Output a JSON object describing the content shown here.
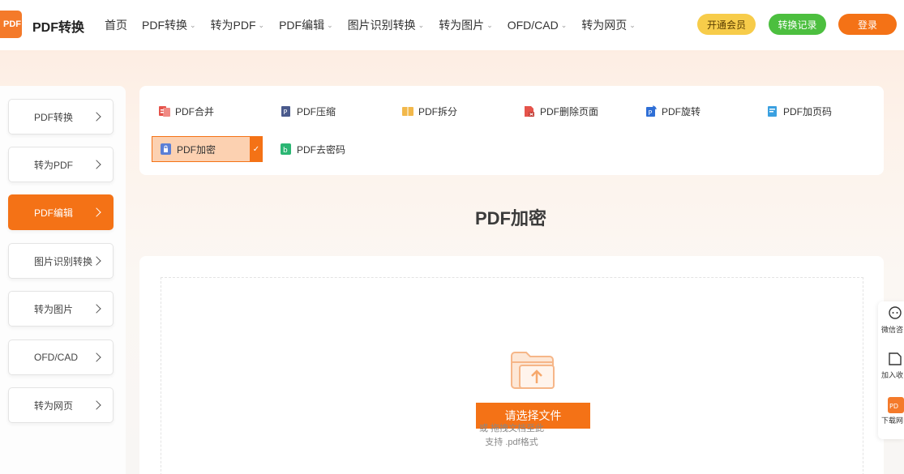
{
  "header": {
    "logo_text": "PDF",
    "brand": "PDF转换",
    "nav": [
      {
        "label": "首页",
        "has_dropdown": false
      },
      {
        "label": "PDF转换",
        "has_dropdown": true
      },
      {
        "label": "转为PDF",
        "has_dropdown": true
      },
      {
        "label": "PDF编辑",
        "has_dropdown": true
      },
      {
        "label": "图片识别转换",
        "has_dropdown": true
      },
      {
        "label": "转为图片",
        "has_dropdown": true
      },
      {
        "label": "OFD/CAD",
        "has_dropdown": true
      },
      {
        "label": "转为网页",
        "has_dropdown": true
      }
    ],
    "vip_label": "开通会员",
    "record_label": "转换记录",
    "login_label": "登录"
  },
  "sidebar": {
    "items": [
      {
        "label": "PDF转换",
        "active": false
      },
      {
        "label": "转为PDF",
        "active": false
      },
      {
        "label": "PDF编辑",
        "active": true
      },
      {
        "label": "图片识别转换",
        "active": false
      },
      {
        "label": "转为图片",
        "active": false
      },
      {
        "label": "OFD/CAD",
        "active": false
      },
      {
        "label": "转为网页",
        "active": false
      }
    ]
  },
  "tools": {
    "items": [
      {
        "label": "PDF合并",
        "icon": "merge-icon",
        "color": "#e5534b"
      },
      {
        "label": "PDF压缩",
        "icon": "compress-icon",
        "color": "#4a5a8c"
      },
      {
        "label": "PDF拆分",
        "icon": "split-icon",
        "color": "#f2b84b"
      },
      {
        "label": "PDF删除页面",
        "icon": "delete-page-icon",
        "color": "#e5534b"
      },
      {
        "label": "PDF旋转",
        "icon": "rotate-icon",
        "color": "#2f6fd6"
      },
      {
        "label": "PDF加页码",
        "icon": "page-number-icon",
        "color": "#3aa0e0"
      },
      {
        "label": "PDF加密",
        "icon": "lock-icon",
        "color": "#5b7fd6",
        "selected": true
      },
      {
        "label": "PDF去密码",
        "icon": "unlock-icon",
        "color": "#2bb673"
      }
    ]
  },
  "main": {
    "title": "PDF加密",
    "choose_button": "请选择文件",
    "drag_hint": "或 拖拽文档至此",
    "format_hint": "支持 .pdf格式"
  },
  "float_bar": {
    "items": [
      {
        "label": "微信咨",
        "icon": "wechat-icon"
      },
      {
        "label": "加入收",
        "icon": "bookmark-icon"
      },
      {
        "label": "下载网",
        "icon": "download-app-icon"
      }
    ]
  },
  "colors": {
    "accent": "#f47216",
    "vip": "#f7cc4a",
    "record": "#4cbf3f"
  }
}
